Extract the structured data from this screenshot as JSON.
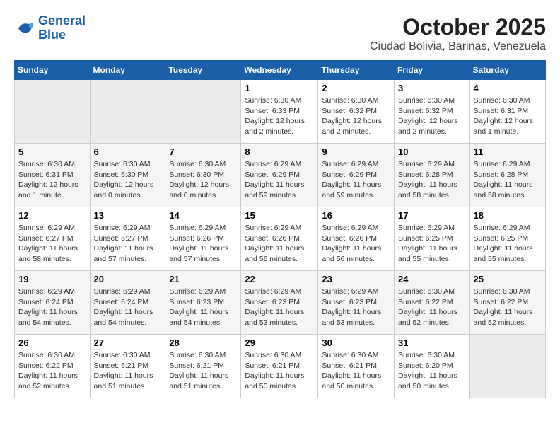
{
  "header": {
    "logo_line1": "General",
    "logo_line2": "Blue",
    "month": "October 2025",
    "location": "Ciudad Bolivia, Barinas, Venezuela"
  },
  "weekdays": [
    "Sunday",
    "Monday",
    "Tuesday",
    "Wednesday",
    "Thursday",
    "Friday",
    "Saturday"
  ],
  "weeks": [
    [
      {
        "day": "",
        "info": ""
      },
      {
        "day": "",
        "info": ""
      },
      {
        "day": "",
        "info": ""
      },
      {
        "day": "1",
        "info": "Sunrise: 6:30 AM\nSunset: 6:33 PM\nDaylight: 12 hours\nand 2 minutes."
      },
      {
        "day": "2",
        "info": "Sunrise: 6:30 AM\nSunset: 6:32 PM\nDaylight: 12 hours\nand 2 minutes."
      },
      {
        "day": "3",
        "info": "Sunrise: 6:30 AM\nSunset: 6:32 PM\nDaylight: 12 hours\nand 2 minutes."
      },
      {
        "day": "4",
        "info": "Sunrise: 6:30 AM\nSunset: 6:31 PM\nDaylight: 12 hours\nand 1 minute."
      }
    ],
    [
      {
        "day": "5",
        "info": "Sunrise: 6:30 AM\nSunset: 6:31 PM\nDaylight: 12 hours\nand 1 minute."
      },
      {
        "day": "6",
        "info": "Sunrise: 6:30 AM\nSunset: 6:30 PM\nDaylight: 12 hours\nand 0 minutes."
      },
      {
        "day": "7",
        "info": "Sunrise: 6:30 AM\nSunset: 6:30 PM\nDaylight: 12 hours\nand 0 minutes."
      },
      {
        "day": "8",
        "info": "Sunrise: 6:29 AM\nSunset: 6:29 PM\nDaylight: 11 hours\nand 59 minutes."
      },
      {
        "day": "9",
        "info": "Sunrise: 6:29 AM\nSunset: 6:29 PM\nDaylight: 11 hours\nand 59 minutes."
      },
      {
        "day": "10",
        "info": "Sunrise: 6:29 AM\nSunset: 6:28 PM\nDaylight: 11 hours\nand 58 minutes."
      },
      {
        "day": "11",
        "info": "Sunrise: 6:29 AM\nSunset: 6:28 PM\nDaylight: 11 hours\nand 58 minutes."
      }
    ],
    [
      {
        "day": "12",
        "info": "Sunrise: 6:29 AM\nSunset: 6:27 PM\nDaylight: 11 hours\nand 58 minutes."
      },
      {
        "day": "13",
        "info": "Sunrise: 6:29 AM\nSunset: 6:27 PM\nDaylight: 11 hours\nand 57 minutes."
      },
      {
        "day": "14",
        "info": "Sunrise: 6:29 AM\nSunset: 6:26 PM\nDaylight: 11 hours\nand 57 minutes."
      },
      {
        "day": "15",
        "info": "Sunrise: 6:29 AM\nSunset: 6:26 PM\nDaylight: 11 hours\nand 56 minutes."
      },
      {
        "day": "16",
        "info": "Sunrise: 6:29 AM\nSunset: 6:26 PM\nDaylight: 11 hours\nand 56 minutes."
      },
      {
        "day": "17",
        "info": "Sunrise: 6:29 AM\nSunset: 6:25 PM\nDaylight: 11 hours\nand 55 minutes."
      },
      {
        "day": "18",
        "info": "Sunrise: 6:29 AM\nSunset: 6:25 PM\nDaylight: 11 hours\nand 55 minutes."
      }
    ],
    [
      {
        "day": "19",
        "info": "Sunrise: 6:29 AM\nSunset: 6:24 PM\nDaylight: 11 hours\nand 54 minutes."
      },
      {
        "day": "20",
        "info": "Sunrise: 6:29 AM\nSunset: 6:24 PM\nDaylight: 11 hours\nand 54 minutes."
      },
      {
        "day": "21",
        "info": "Sunrise: 6:29 AM\nSunset: 6:23 PM\nDaylight: 11 hours\nand 54 minutes."
      },
      {
        "day": "22",
        "info": "Sunrise: 6:29 AM\nSunset: 6:23 PM\nDaylight: 11 hours\nand 53 minutes."
      },
      {
        "day": "23",
        "info": "Sunrise: 6:29 AM\nSunset: 6:23 PM\nDaylight: 11 hours\nand 53 minutes."
      },
      {
        "day": "24",
        "info": "Sunrise: 6:30 AM\nSunset: 6:22 PM\nDaylight: 11 hours\nand 52 minutes."
      },
      {
        "day": "25",
        "info": "Sunrise: 6:30 AM\nSunset: 6:22 PM\nDaylight: 11 hours\nand 52 minutes."
      }
    ],
    [
      {
        "day": "26",
        "info": "Sunrise: 6:30 AM\nSunset: 6:22 PM\nDaylight: 11 hours\nand 52 minutes."
      },
      {
        "day": "27",
        "info": "Sunrise: 6:30 AM\nSunset: 6:21 PM\nDaylight: 11 hours\nand 51 minutes."
      },
      {
        "day": "28",
        "info": "Sunrise: 6:30 AM\nSunset: 6:21 PM\nDaylight: 11 hours\nand 51 minutes."
      },
      {
        "day": "29",
        "info": "Sunrise: 6:30 AM\nSunset: 6:21 PM\nDaylight: 11 hours\nand 50 minutes."
      },
      {
        "day": "30",
        "info": "Sunrise: 6:30 AM\nSunset: 6:21 PM\nDaylight: 11 hours\nand 50 minutes."
      },
      {
        "day": "31",
        "info": "Sunrise: 6:30 AM\nSunset: 6:20 PM\nDaylight: 11 hours\nand 50 minutes."
      },
      {
        "day": "",
        "info": ""
      }
    ]
  ]
}
